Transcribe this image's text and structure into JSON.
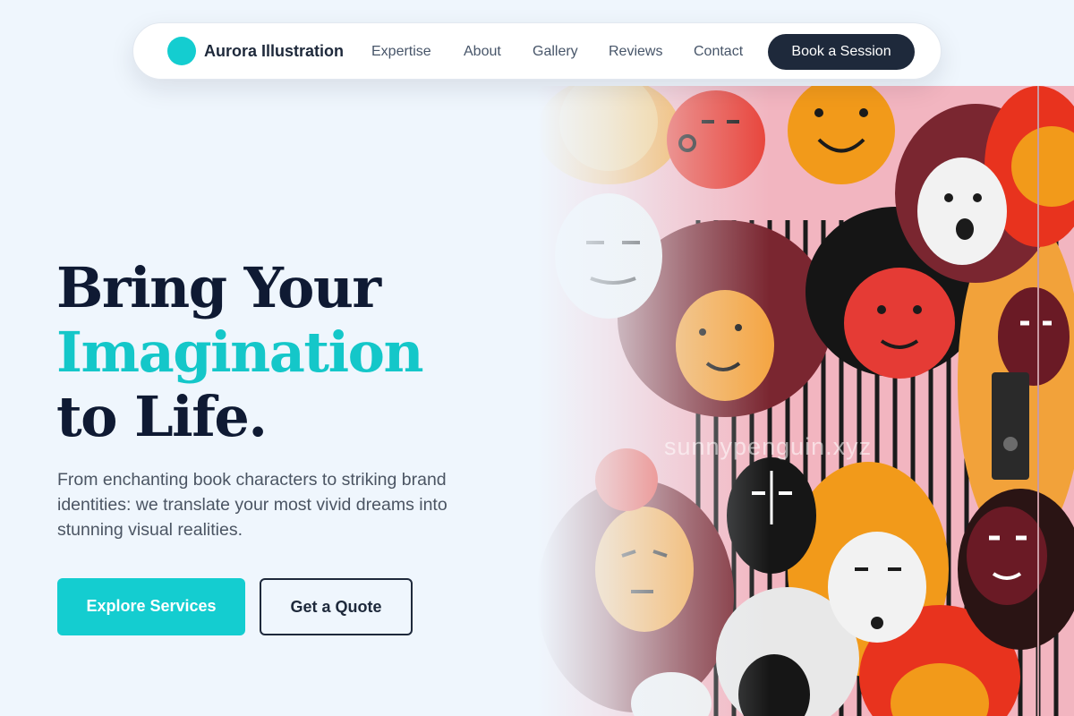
{
  "nav": {
    "brand": "Aurora Illustration",
    "links": [
      "Expertise",
      "About",
      "Gallery",
      "Reviews",
      "Contact"
    ],
    "cta": "Book a Session"
  },
  "hero": {
    "headline_line1": "Bring Your",
    "headline_line2": "Imagination",
    "headline_line3": "to Life.",
    "subtitle": "From enchanting book characters to striking brand identities: we translate your most vivid dreams into stunning visual realities.",
    "primary_button": "Explore Services",
    "secondary_button": "Get a Quote",
    "image_watermark": "sunnypenguin.xyz"
  },
  "colors": {
    "accent": "#14cdd0",
    "dark": "#1e293b",
    "background": "#eff6fd"
  },
  "icons": {
    "brand_logo": "teal-circle-logo-icon"
  }
}
